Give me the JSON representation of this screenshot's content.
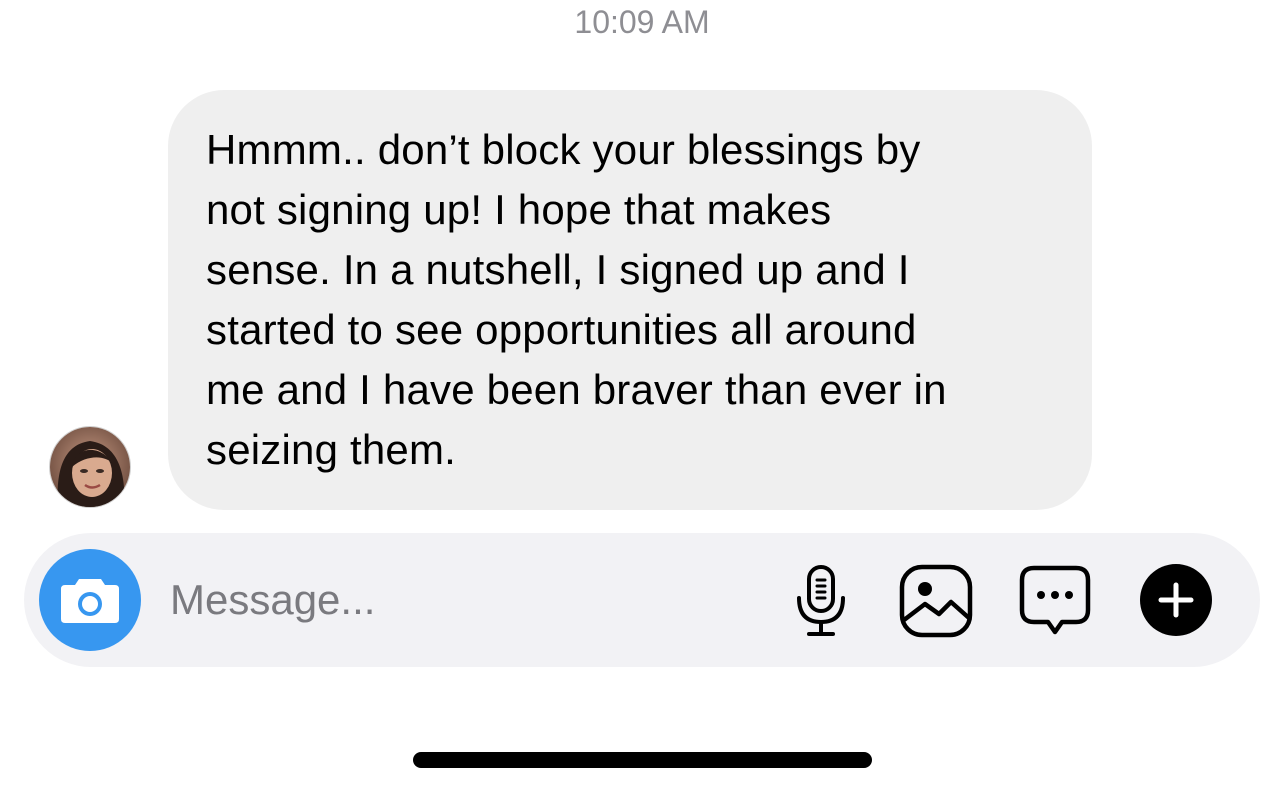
{
  "header": {
    "timestamp": "10:09 AM"
  },
  "conversation": {
    "messages": [
      {
        "sender": "other",
        "avatar_icon": "contact-avatar",
        "text": "Hmmm.. don’t block your blessings by\nnot signing up! I hope that makes\nsense. In a nutshell, I signed up and I\nstarted to see opportunities all around\nme and I have been braver than ever in\nseizing them."
      }
    ]
  },
  "composer": {
    "placeholder": "Message...",
    "value": "",
    "buttons": {
      "camera_icon": "camera-icon",
      "mic_icon": "microphone-icon",
      "gallery_icon": "image-gallery-icon",
      "sticker_icon": "chat-bubble-more-icon",
      "plus_icon": "plus-icon"
    }
  },
  "colors": {
    "accent": "#3797f0",
    "bubble_background": "#efefef",
    "composer_background": "#f2f2f5",
    "timestamp": "#8e8e93",
    "placeholder": "#7a7a7f"
  }
}
